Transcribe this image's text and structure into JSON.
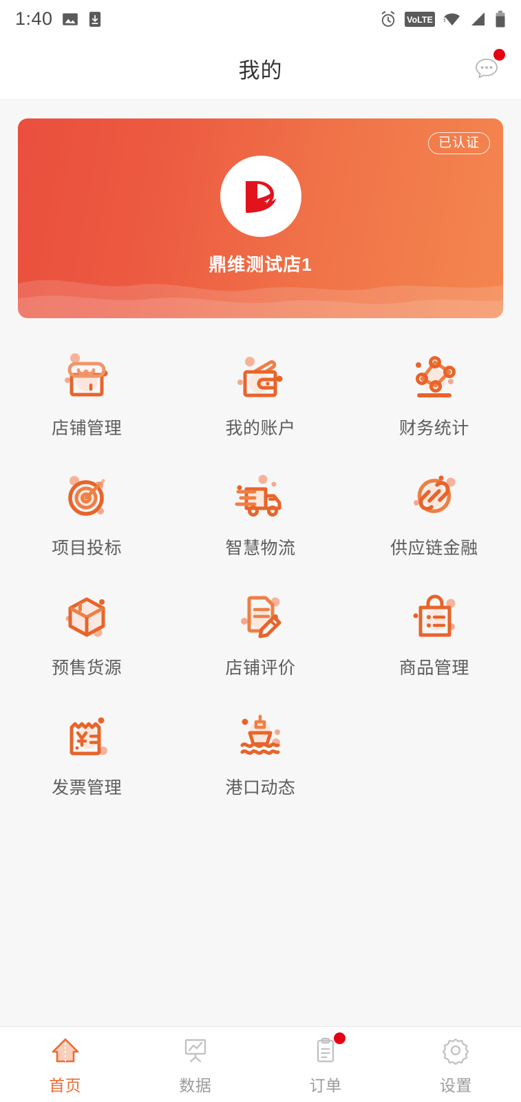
{
  "status_bar": {
    "time": "1:40",
    "left_icons": [
      "image-icon",
      "download-icon"
    ],
    "right_icons": [
      "alarm-icon",
      "volte-icon",
      "wifi-icon",
      "signal-icon",
      "battery-icon"
    ],
    "volte_label": "VoLTE"
  },
  "header": {
    "title": "我的",
    "action_icon": "chat-bubble-icon",
    "has_notification_dot": true
  },
  "profile_card": {
    "badge_label": "已认证",
    "shop_name": "鼎维测试店1",
    "avatar_icon": "company-logo",
    "gradient_start": "#ea4f3d",
    "gradient_end": "#f4864f"
  },
  "menu_grid": [
    {
      "label": "店铺管理",
      "icon": "shop-icon"
    },
    {
      "label": "我的账户",
      "icon": "wallet-icon"
    },
    {
      "label": "财务统计",
      "icon": "line-chart-icon"
    },
    {
      "label": "项目投标",
      "icon": "target-arrow-icon"
    },
    {
      "label": "智慧物流",
      "icon": "delivery-truck-icon"
    },
    {
      "label": "供应链金融",
      "icon": "chain-link-icon"
    },
    {
      "label": "预售货源",
      "icon": "box-3d-icon"
    },
    {
      "label": "店铺评价",
      "icon": "document-pencil-icon"
    },
    {
      "label": "商品管理",
      "icon": "shopping-bag-icon"
    },
    {
      "label": "发票管理",
      "icon": "invoice-yuan-icon"
    },
    {
      "label": "港口动态",
      "icon": "ship-waves-icon"
    }
  ],
  "tab_bar": [
    {
      "label": "首页",
      "icon": "home-icon",
      "active": true,
      "badge": false
    },
    {
      "label": "数据",
      "icon": "chart-board-icon",
      "active": false,
      "badge": false
    },
    {
      "label": "订单",
      "icon": "clipboard-icon",
      "active": false,
      "badge": true
    },
    {
      "label": "设置",
      "icon": "gear-icon",
      "active": false,
      "badge": false
    }
  ],
  "colors": {
    "accent": "#ef6b32",
    "badge_red": "#e60012",
    "page_bg": "#f7f7f7",
    "label_gray": "#5c5c5c"
  }
}
